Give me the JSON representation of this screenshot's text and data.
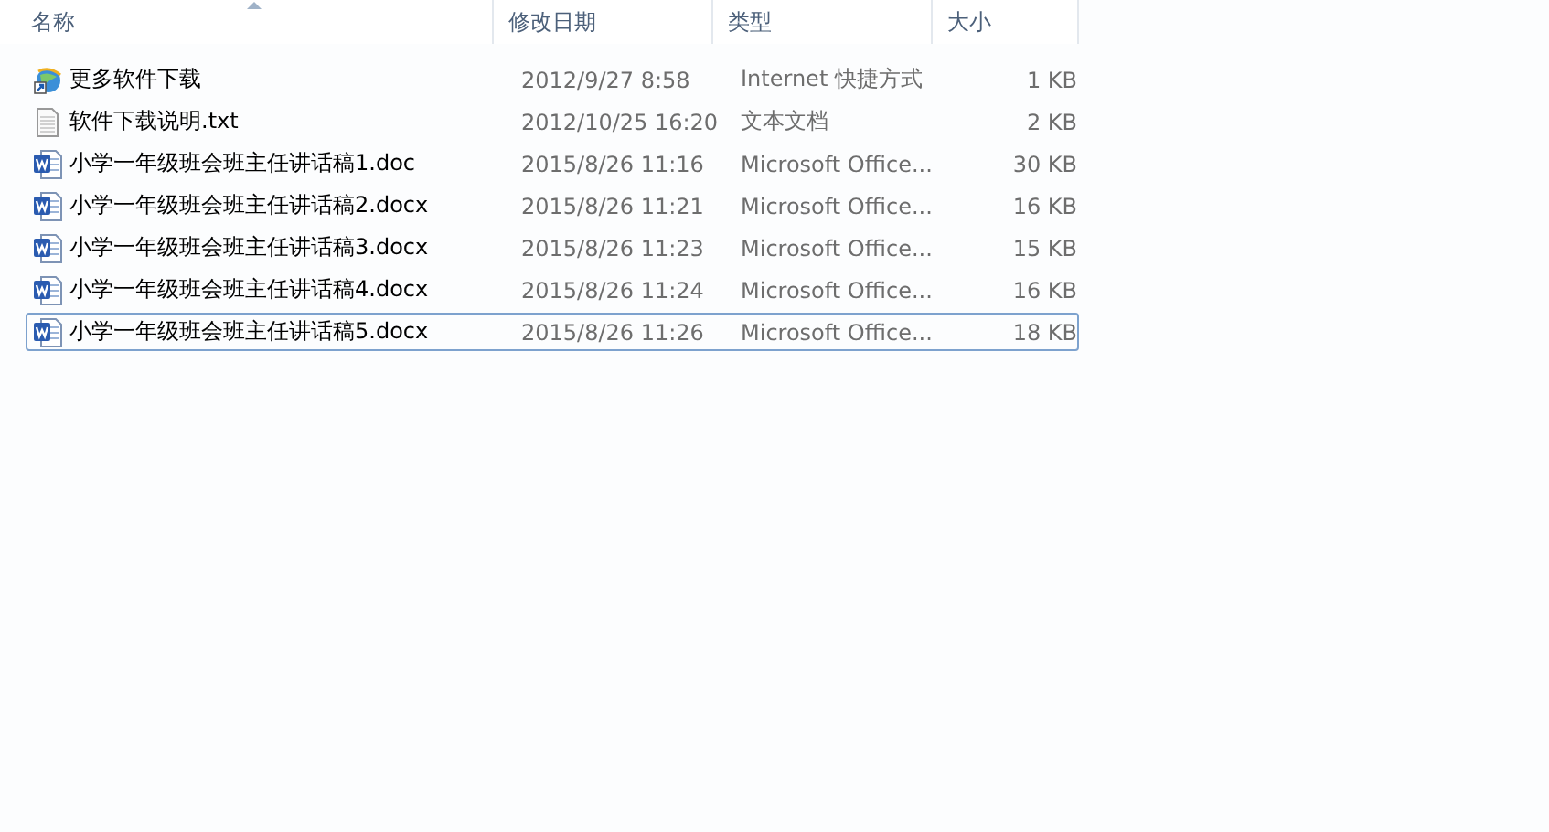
{
  "columns": [
    {
      "label": "名称",
      "sorted": true
    },
    {
      "label": "修改日期",
      "sorted": false
    },
    {
      "label": "类型",
      "sorted": false
    },
    {
      "label": "大小",
      "sorted": false
    }
  ],
  "files": [
    {
      "kind": "shortcut",
      "name": "更多软件下载",
      "date": "2012/9/27 8:58",
      "type": "Internet 快捷方式",
      "size": "1 KB",
      "focused": false
    },
    {
      "kind": "text",
      "name": "软件下载说明.txt",
      "date": "2012/10/25 16:20",
      "type": "文本文档",
      "size": "2 KB",
      "focused": false
    },
    {
      "kind": "word",
      "name": "小学一年级班会班主任讲话稿1.doc",
      "date": "2015/8/26 11:16",
      "type": "Microsoft Office...",
      "size": "30 KB",
      "focused": false
    },
    {
      "kind": "word",
      "name": "小学一年级班会班主任讲话稿2.docx",
      "date": "2015/8/26 11:21",
      "type": "Microsoft Office...",
      "size": "16 KB",
      "focused": false
    },
    {
      "kind": "word",
      "name": "小学一年级班会班主任讲话稿3.docx",
      "date": "2015/8/26 11:23",
      "type": "Microsoft Office...",
      "size": "15 KB",
      "focused": false
    },
    {
      "kind": "word",
      "name": "小学一年级班会班主任讲话稿4.docx",
      "date": "2015/8/26 11:24",
      "type": "Microsoft Office...",
      "size": "16 KB",
      "focused": false
    },
    {
      "kind": "word",
      "name": "小学一年级班会班主任讲话稿5.docx",
      "date": "2015/8/26 11:26",
      "type": "Microsoft Office...",
      "size": "18 KB",
      "focused": true
    }
  ]
}
